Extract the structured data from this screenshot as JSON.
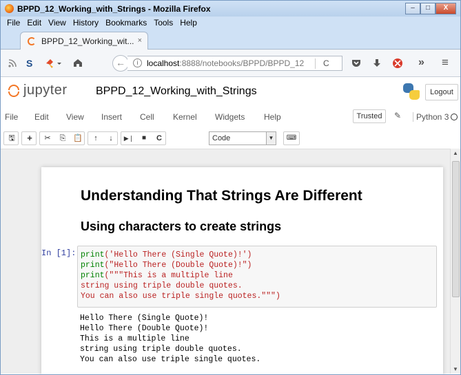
{
  "window": {
    "title": "BPPD_12_Working_with_Strings - Mozilla Firefox",
    "minimize": "–",
    "maximize": "□",
    "close": "X"
  },
  "menubar": [
    "File",
    "Edit",
    "View",
    "History",
    "Bookmarks",
    "Tools",
    "Help"
  ],
  "tab": {
    "label": "BPPD_12_Working_wit...",
    "close": "×"
  },
  "navbar": {
    "url_host": "localhost",
    "url_path": ":8888/notebooks/BPPD/BPPD_12",
    "back": "←",
    "reload": "C",
    "overflow": "»",
    "menu": "≡"
  },
  "jupyter": {
    "wordmark": "jupyter",
    "notebook_title": "BPPD_12_Working_with_Strings",
    "logout": "Logout",
    "menu": [
      "File",
      "Edit",
      "View",
      "Insert",
      "Cell",
      "Kernel",
      "Widgets",
      "Help"
    ],
    "trusted": "Trusted",
    "kernel": "Python 3",
    "celltype": "Code"
  },
  "notebook": {
    "heading1": "Understanding That Strings Are Different",
    "heading2": "Using characters to create strings",
    "prompt": "In [1]:",
    "code_lines": [
      {
        "fn": "print",
        "arg": "('Hello There (Single Quote)!')"
      },
      {
        "fn": "print",
        "arg": "(\"Hello There (Double Quote)!\")"
      },
      {
        "fn": "print",
        "arg": "(\"\"\"This is a multiple line"
      },
      {
        "fn": "",
        "arg": "string using triple double quotes."
      },
      {
        "fn": "",
        "arg": "You can also use triple single quotes.\"\"\")"
      }
    ],
    "output": "Hello There (Single Quote)!\nHello There (Double Quote)!\nThis is a multiple line\nstring using triple double quotes.\nYou can also use triple single quotes."
  }
}
